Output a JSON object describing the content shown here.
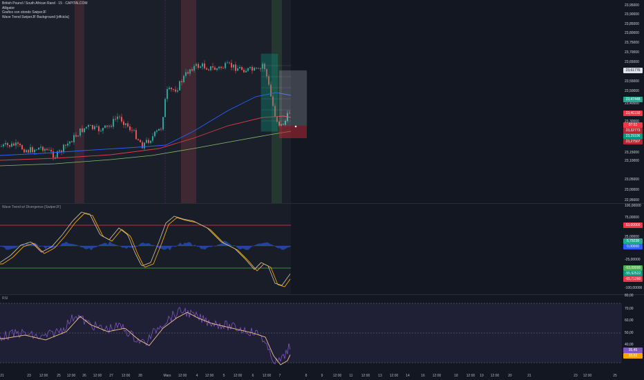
{
  "legend": {
    "symbol_line": "British Pound / South African Rand · 15 · CAPITALCOM",
    "line2": "Alligator",
    "line3": "Grafico con stondo SwiperJF",
    "line4": "Wave Trend SwiperJF Background [offcicla]"
  },
  "price_scale": {
    "ticks": [
      "23,95000",
      "23,90000",
      "23,85000",
      "23,80000",
      "23,75000",
      "23,70000",
      "23,65000",
      "23,55000",
      "23,50000",
      "23,40000",
      "23,30000",
      "23,20000",
      "23,15000",
      "23,10000",
      "23,05000",
      "23,00000",
      "22,95000"
    ],
    "tags": [
      {
        "label": "23,61776",
        "color": "#e0e3eb",
        "text": "#131722"
      },
      {
        "label": "23,47448",
        "color": "#22ab94",
        "text": "#ffffff"
      },
      {
        "label": "23,40150",
        "color": "#f23645",
        "text": "#ffffff"
      },
      {
        "label": "07:51",
        "color": "#f23645",
        "text": "#ffffff"
      },
      {
        "label": "23,32773",
        "color": "#b22833",
        "text": "#ffffff"
      },
      {
        "label": "23,29196",
        "color": "#089981",
        "text": "#ffffff"
      },
      {
        "label": "23,27507",
        "color": "#b22833",
        "text": "#ffffff"
      }
    ]
  },
  "wavetrend": {
    "title": "Wave Trend w/ Divergence [SwiperJF]",
    "ticks": [
      "100,00000",
      "75,00000",
      "25,00000",
      "-25,00000",
      "-100,00000"
    ],
    "tags": [
      {
        "label": "53,00000",
        "color": "#f23645"
      },
      {
        "label": "5,79238",
        "color": "#22ab94"
      },
      {
        "label": "0,00000",
        "color": "#2962ff"
      },
      {
        "label": "-53,00000",
        "color": "#4caf50"
      },
      {
        "label": "-55,92522",
        "color": "#089981"
      },
      {
        "label": "-65,71260",
        "color": "#f23645"
      }
    ]
  },
  "rsi": {
    "title": "RSI",
    "ticks": [
      "80,00",
      "70,00",
      "60,00",
      "50,00",
      "40,00"
    ],
    "tags": [
      {
        "label": "35,45",
        "color": "#7e57c2"
      },
      {
        "label": "33,82",
        "color": "#f7a600"
      }
    ]
  },
  "time_axis": [
    "21",
    "23",
    "12:00",
    "25",
    "12:00",
    "26",
    "12:00",
    "27",
    "12:00",
    "28",
    "Mars",
    "12:00",
    "4",
    "12:00",
    "5",
    "12:00",
    "6",
    "12:00",
    "7",
    "8",
    "9",
    "12:00",
    "11",
    "12:00",
    "13",
    "12:00",
    "14",
    "16",
    "12:00",
    "18",
    "12:00",
    "19",
    "12:00",
    "20",
    "21",
    "23",
    "12:00",
    "25"
  ],
  "colors": {
    "bg": "#131722",
    "up": "#26a69a",
    "down": "#ef5350",
    "ma_blue": "#2962ff",
    "ma_red": "#e53945",
    "ma_green": "#4caf50",
    "rsi": "#7e57c2",
    "rsi_ma": "#f7c38a"
  }
}
